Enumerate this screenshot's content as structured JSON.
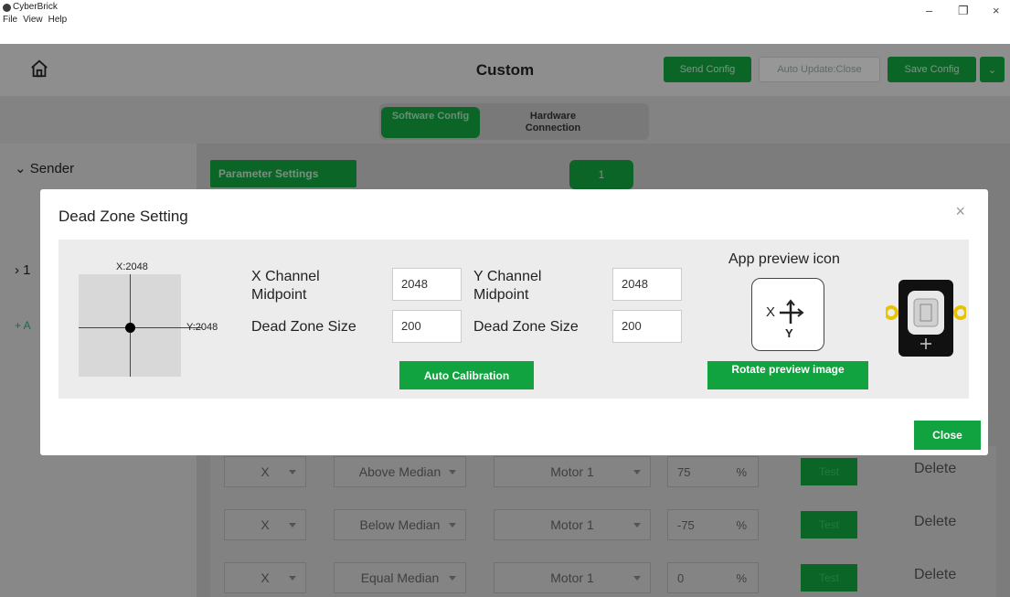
{
  "window": {
    "title": "CyberBrick",
    "menu": [
      "File",
      "View",
      "Help"
    ],
    "controls": {
      "minimize": "–",
      "restore": "❐",
      "close": "×"
    }
  },
  "header": {
    "title": "Custom",
    "send_config": "Send Config",
    "auto_update": "Auto Update:Close",
    "save_config": "Save Config",
    "dropdown": "⌄"
  },
  "tabs": {
    "software": "Software Config",
    "hardware": "Hardware Connection"
  },
  "sidebar": {
    "sender": "Sender",
    "item1": "1",
    "add": "+ A"
  },
  "main": {
    "param_settings": "Parameter Settings",
    "page": "1",
    "rows": [
      {
        "axis": "X",
        "condition": "Above Median",
        "motor": "Motor 1",
        "value": "75",
        "unit": "%",
        "test": "Test",
        "delete": "Delete"
      },
      {
        "axis": "X",
        "condition": "Below Median",
        "motor": "Motor 1",
        "value": "-75",
        "unit": "%",
        "test": "Test",
        "delete": "Delete"
      },
      {
        "axis": "X",
        "condition": "Equal Median",
        "motor": "Motor 1",
        "value": "0",
        "unit": "%",
        "test": "Test",
        "delete": "Delete"
      }
    ]
  },
  "modal": {
    "title": "Dead Zone Setting",
    "close_x": "×",
    "x_readout": "X:2048",
    "y_readout": "Y:2048",
    "x_mid_label": "X Channel Midpoint",
    "x_mid_value": "2048",
    "y_mid_label": "Y Channel Midpoint",
    "y_mid_value": "2048",
    "x_dz_label": "Dead Zone Size",
    "x_dz_value": "200",
    "y_dz_label": "Dead Zone Size",
    "y_dz_value": "200",
    "auto_calibration": "Auto Calibration",
    "preview_title": "App preview icon",
    "preview_x": "X",
    "preview_y": "Y",
    "rotate_preview": "Rotate preview image",
    "close": "Close"
  },
  "colors": {
    "accent": "#11a33f",
    "overlay": "rgba(0,0,0,0.38)"
  }
}
